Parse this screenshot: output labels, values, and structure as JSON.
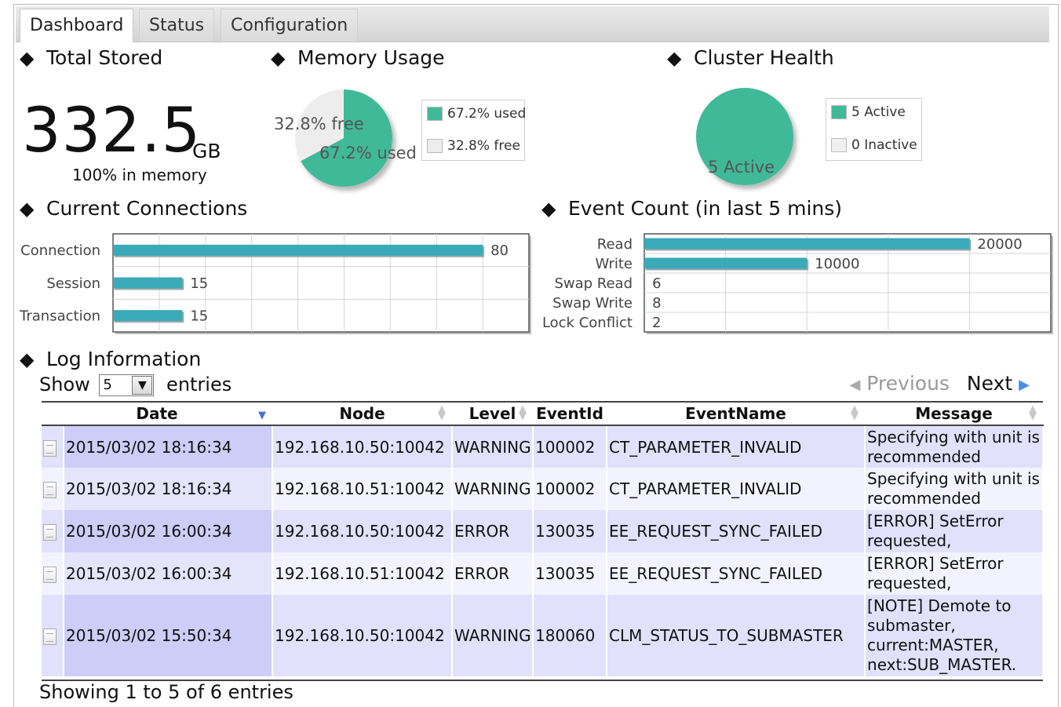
{
  "tabs": [
    "Dashboard",
    "Status",
    "Configuration"
  ],
  "sections": {
    "total_stored": "Total Stored",
    "memory_usage": "Memory Usage",
    "cluster_health": "Cluster Health",
    "current_connections": "Current Connections",
    "event_count": "Event Count (in last 5 mins)",
    "log_information": "Log Information"
  },
  "total_stored": {
    "value": "332.5",
    "unit": "GB",
    "note": "100% in memory"
  },
  "memory_usage": {
    "free_label": "32.8% free",
    "used_label": "67.2% used",
    "legend": [
      "67.2% used",
      "32.8% free"
    ],
    "used_fraction": 0.672,
    "colors": {
      "used": "#40b999",
      "free": "#ededed"
    }
  },
  "cluster_health": {
    "slice_label": "5 Active",
    "legend": [
      "5 Active",
      "0 Inactive"
    ],
    "active": 5,
    "inactive": 0
  },
  "chart_data": [
    {
      "type": "bar",
      "orientation": "horizontal",
      "categories": [
        "Connection",
        "Session",
        "Transaction"
      ],
      "values": [
        80,
        15,
        15
      ],
      "xlim": [
        0,
        90
      ],
      "grid": true,
      "color": "#3aa9b8"
    },
    {
      "type": "bar",
      "orientation": "horizontal",
      "categories": [
        "Read",
        "Write",
        "Swap Read",
        "Swap Write",
        "Lock Conflict"
      ],
      "values": [
        20000,
        10000,
        6,
        8,
        2
      ],
      "xlim": [
        0,
        25000
      ],
      "grid": true,
      "color": "#3aa9b8"
    }
  ],
  "log": {
    "show_label": "Show",
    "entries_label": "entries",
    "page_size": "5",
    "prev_label": "Previous",
    "next_label": "Next",
    "columns": [
      "Date",
      "Node",
      "Level",
      "EventId",
      "EventName",
      "Message"
    ],
    "rows": [
      {
        "date": "2015/03/02 18:16:34",
        "node": "192.168.10.50:10042",
        "level": "WARNING",
        "event_id": "100002",
        "event_name": "CT_PARAMETER_INVALID",
        "message": "Specifying with unit is recommended"
      },
      {
        "date": "2015/03/02 18:16:34",
        "node": "192.168.10.51:10042",
        "level": "WARNING",
        "event_id": "100002",
        "event_name": "CT_PARAMETER_INVALID",
        "message": "Specifying with unit is recommended"
      },
      {
        "date": "2015/03/02 16:00:34",
        "node": "192.168.10.50:10042",
        "level": "ERROR",
        "event_id": "130035",
        "event_name": "EE_REQUEST_SYNC_FAILED",
        "message": "[ERROR] SetError requested,"
      },
      {
        "date": "2015/03/02 16:00:34",
        "node": "192.168.10.51:10042",
        "level": "ERROR",
        "event_id": "130035",
        "event_name": "EE_REQUEST_SYNC_FAILED",
        "message": "[ERROR] SetError requested,"
      },
      {
        "date": "2015/03/02 15:50:34",
        "node": "192.168.10.50:10042",
        "level": "WARNING",
        "event_id": "180060",
        "event_name": "CLM_STATUS_TO_SUBMASTER",
        "message": "[NOTE] Demote to submaster, current:MASTER, next:SUB_MASTER."
      }
    ],
    "info": "Showing 1 to 5 of 6 entries"
  }
}
